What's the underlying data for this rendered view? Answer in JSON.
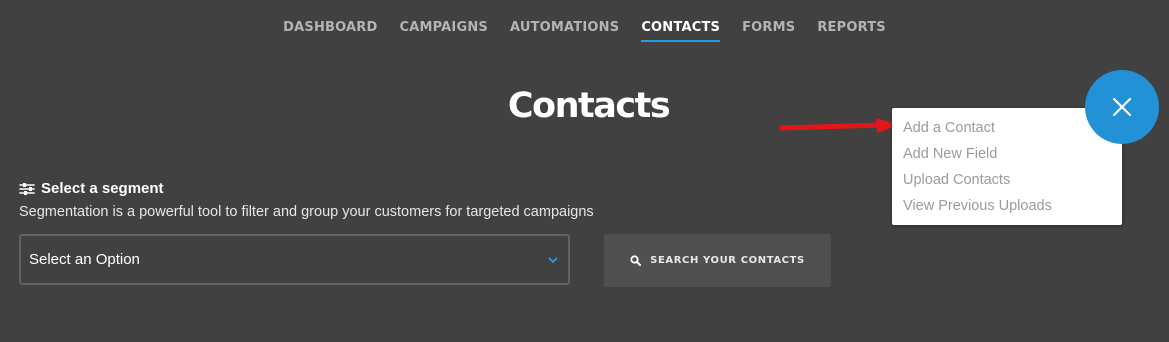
{
  "nav": {
    "items": [
      {
        "label": "DASHBOARD",
        "active": false
      },
      {
        "label": "CAMPAIGNS",
        "active": false
      },
      {
        "label": "AUTOMATIONS",
        "active": false
      },
      {
        "label": "CONTACTS",
        "active": true
      },
      {
        "label": "FORMS",
        "active": false
      },
      {
        "label": "REPORTS",
        "active": false
      }
    ],
    "active_color": "#2a9bd9"
  },
  "page": {
    "title": "Contacts"
  },
  "segment": {
    "heading": "Select a segment",
    "icon": "sliders-icon",
    "description": "Segmentation is a powerful tool to filter and group your customers for targeted campaigns",
    "select_value": "Select an Option",
    "search_button": "SEARCH YOUR CONTACTS"
  },
  "menu": {
    "items": [
      "Add a Contact",
      "Add New Field",
      "Upload Contacts",
      "View Previous Uploads"
    ]
  },
  "fab": {
    "icon": "close-icon",
    "color": "#2291d6"
  },
  "colors": {
    "background": "#414141",
    "arrow": "#e3161b"
  }
}
